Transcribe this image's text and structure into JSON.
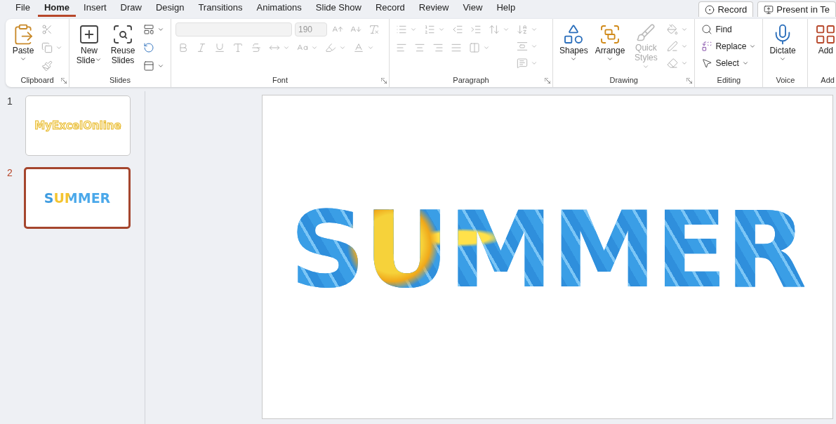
{
  "menu_tabs": [
    {
      "label": "File",
      "selected": false
    },
    {
      "label": "Home",
      "selected": true
    },
    {
      "label": "Insert",
      "selected": false
    },
    {
      "label": "Draw",
      "selected": false
    },
    {
      "label": "Design",
      "selected": false
    },
    {
      "label": "Transitions",
      "selected": false
    },
    {
      "label": "Animations",
      "selected": false
    },
    {
      "label": "Slide Show",
      "selected": false
    },
    {
      "label": "Record",
      "selected": false
    },
    {
      "label": "Review",
      "selected": false
    },
    {
      "label": "View",
      "selected": false
    },
    {
      "label": "Help",
      "selected": false
    }
  ],
  "header_buttons": [
    {
      "label": "Record"
    },
    {
      "label": "Present in Te"
    }
  ],
  "ribbon": {
    "clipboard": {
      "label": "Clipboard",
      "paste": "Paste"
    },
    "slides": {
      "label": "Slides",
      "new_slide": "New Slide",
      "reuse_slides": "Reuse Slides"
    },
    "font": {
      "label": "Font",
      "disabled": true,
      "size": "190"
    },
    "paragraph": {
      "label": "Paragraph",
      "disabled": true
    },
    "drawing": {
      "label": "Drawing",
      "shapes": "Shapes",
      "arrange": "Arrange",
      "quick_styles": {
        "label": "Quick Styles",
        "disabled": true
      }
    },
    "editing": {
      "label": "Editing",
      "find": "Find",
      "replace": "Replace",
      "select": "Select"
    },
    "voice": {
      "label": "Voice",
      "dictate": "Dictate"
    },
    "group_8": {
      "label": "Add",
      "button": "Add"
    }
  },
  "slides": [
    {
      "number": "1",
      "title": "MyExcelOnline",
      "selected": false
    },
    {
      "number": "2",
      "title": "SUMMER",
      "selected": true
    }
  ],
  "current_slide": {
    "title": "SUMMER"
  }
}
